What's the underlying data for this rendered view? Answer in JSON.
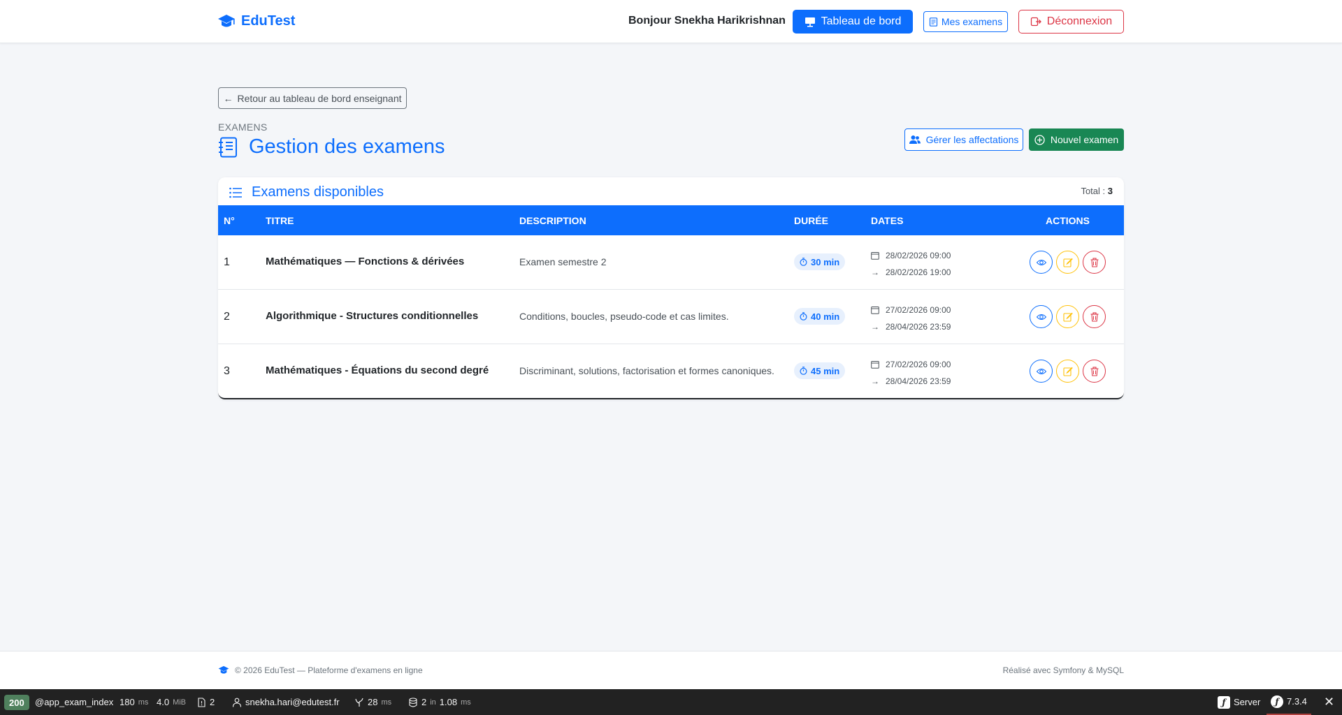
{
  "navbar": {
    "brand": "EduTest",
    "greeting": "Bonjour Snekha Harikrishnan",
    "dashboard_label": "Tableau de bord",
    "my_exams_label": "Mes examens",
    "logout_label": "Déconnexion"
  },
  "back_label": "Retour au tableau de bord enseignant",
  "header": {
    "eyebrow": "EXAMENS",
    "title": "Gestion des examens",
    "assignments_label": "Gérer les affectations",
    "new_exam_label": "Nouvel examen"
  },
  "card": {
    "title": "Examens disponibles",
    "total_label": "Total :",
    "total_value": "3"
  },
  "table": {
    "columns": [
      "N°",
      "TITRE",
      "DESCRIPTION",
      "DURÉE",
      "DATES",
      "ACTIONS"
    ],
    "rows": [
      {
        "num": "1",
        "title": "Mathématiques — Fonctions & dérivées",
        "description": "Examen semestre 2",
        "duration": "30 min",
        "start": "28/02/2026 09:00",
        "end": "28/02/2026 19:00"
      },
      {
        "num": "2",
        "title": "Algorithmique - Structures conditionnelles",
        "description": "Conditions, boucles, pseudo-code et cas limites.",
        "duration": "40 min",
        "start": "27/02/2026 09:00",
        "end": "28/04/2026 23:59"
      },
      {
        "num": "3",
        "title": "Mathématiques - Équations du second degré",
        "description": "Discriminant, solutions, factorisation et formes canoniques.",
        "duration": "45 min",
        "start": "27/02/2026 09:00",
        "end": "28/04/2026 23:59"
      }
    ]
  },
  "footer": {
    "copyright": "© 2026 EduTest — Plateforme d'examens en ligne",
    "credits": "Réalisé avec Symfony & MySQL"
  },
  "debug": {
    "status": "200",
    "route": "@app_exam_index",
    "time_value": "180",
    "time_unit": "ms",
    "memory_value": "4.0",
    "memory_unit": "MiB",
    "forms_count": "2",
    "user": "snekha.hari@edutest.fr",
    "twig_value": "28",
    "twig_unit": "ms",
    "db_queries": "2",
    "db_in": "in",
    "db_time": "1.08",
    "db_unit": "ms",
    "server_label": "Server",
    "symfony_version": "7.3.4"
  },
  "colors": {
    "primary": "#0d6efd",
    "success": "#198754",
    "danger": "#dc3545",
    "warning": "#ffc107"
  }
}
